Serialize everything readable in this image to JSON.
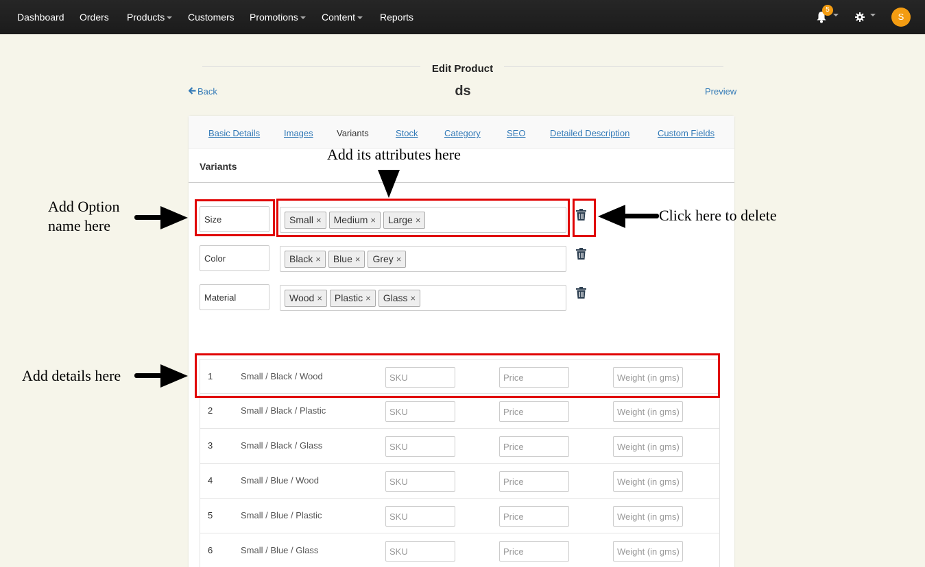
{
  "topnav": {
    "items": [
      {
        "label": "Dashboard",
        "dropdown": false
      },
      {
        "label": "Orders",
        "dropdown": false
      },
      {
        "label": "Products",
        "dropdown": true
      },
      {
        "label": "Customers",
        "dropdown": false
      },
      {
        "label": "Promotions",
        "dropdown": true
      },
      {
        "label": "Content",
        "dropdown": true
      },
      {
        "label": "Reports",
        "dropdown": false
      }
    ],
    "notification_count": "5",
    "avatar_initial": "S",
    "accent_color": "#f39c12"
  },
  "header": {
    "title": "Edit Product",
    "back_label": "Back",
    "product_name": "ds",
    "preview_label": "Preview"
  },
  "tabs": [
    {
      "label": "Basic Details",
      "active": false
    },
    {
      "label": "Images",
      "active": false
    },
    {
      "label": "Variants",
      "active": true
    },
    {
      "label": "Stock",
      "active": false
    },
    {
      "label": "Category",
      "active": false
    },
    {
      "label": "SEO",
      "active": false
    },
    {
      "label": "Detailed Description",
      "active": false
    },
    {
      "label": "Custom Fields",
      "active": false
    }
  ],
  "variants_section": {
    "title": "Variants",
    "options": [
      {
        "name": "Size",
        "values": [
          "Small",
          "Medium",
          "Large"
        ]
      },
      {
        "name": "Color",
        "values": [
          "Black",
          "Blue",
          "Grey"
        ]
      },
      {
        "name": "Material",
        "values": [
          "Wood",
          "Plastic",
          "Glass"
        ]
      }
    ],
    "rows": [
      {
        "num": "1",
        "label": "Small / Black / Wood"
      },
      {
        "num": "2",
        "label": "Small / Black / Plastic"
      },
      {
        "num": "3",
        "label": "Small / Black / Glass"
      },
      {
        "num": "4",
        "label": "Small / Blue / Wood"
      },
      {
        "num": "5",
        "label": "Small / Blue / Plastic"
      },
      {
        "num": "6",
        "label": "Small / Blue / Glass"
      }
    ],
    "placeholders": {
      "sku": "SKU",
      "price": "Price",
      "weight": "Weight (in gms)"
    }
  },
  "annotations": {
    "option_name": "Add Option\nname here",
    "attributes": "Add its attributes here",
    "delete": "Click here to delete",
    "details": "Add details here",
    "highlight_color": "#e00000"
  }
}
